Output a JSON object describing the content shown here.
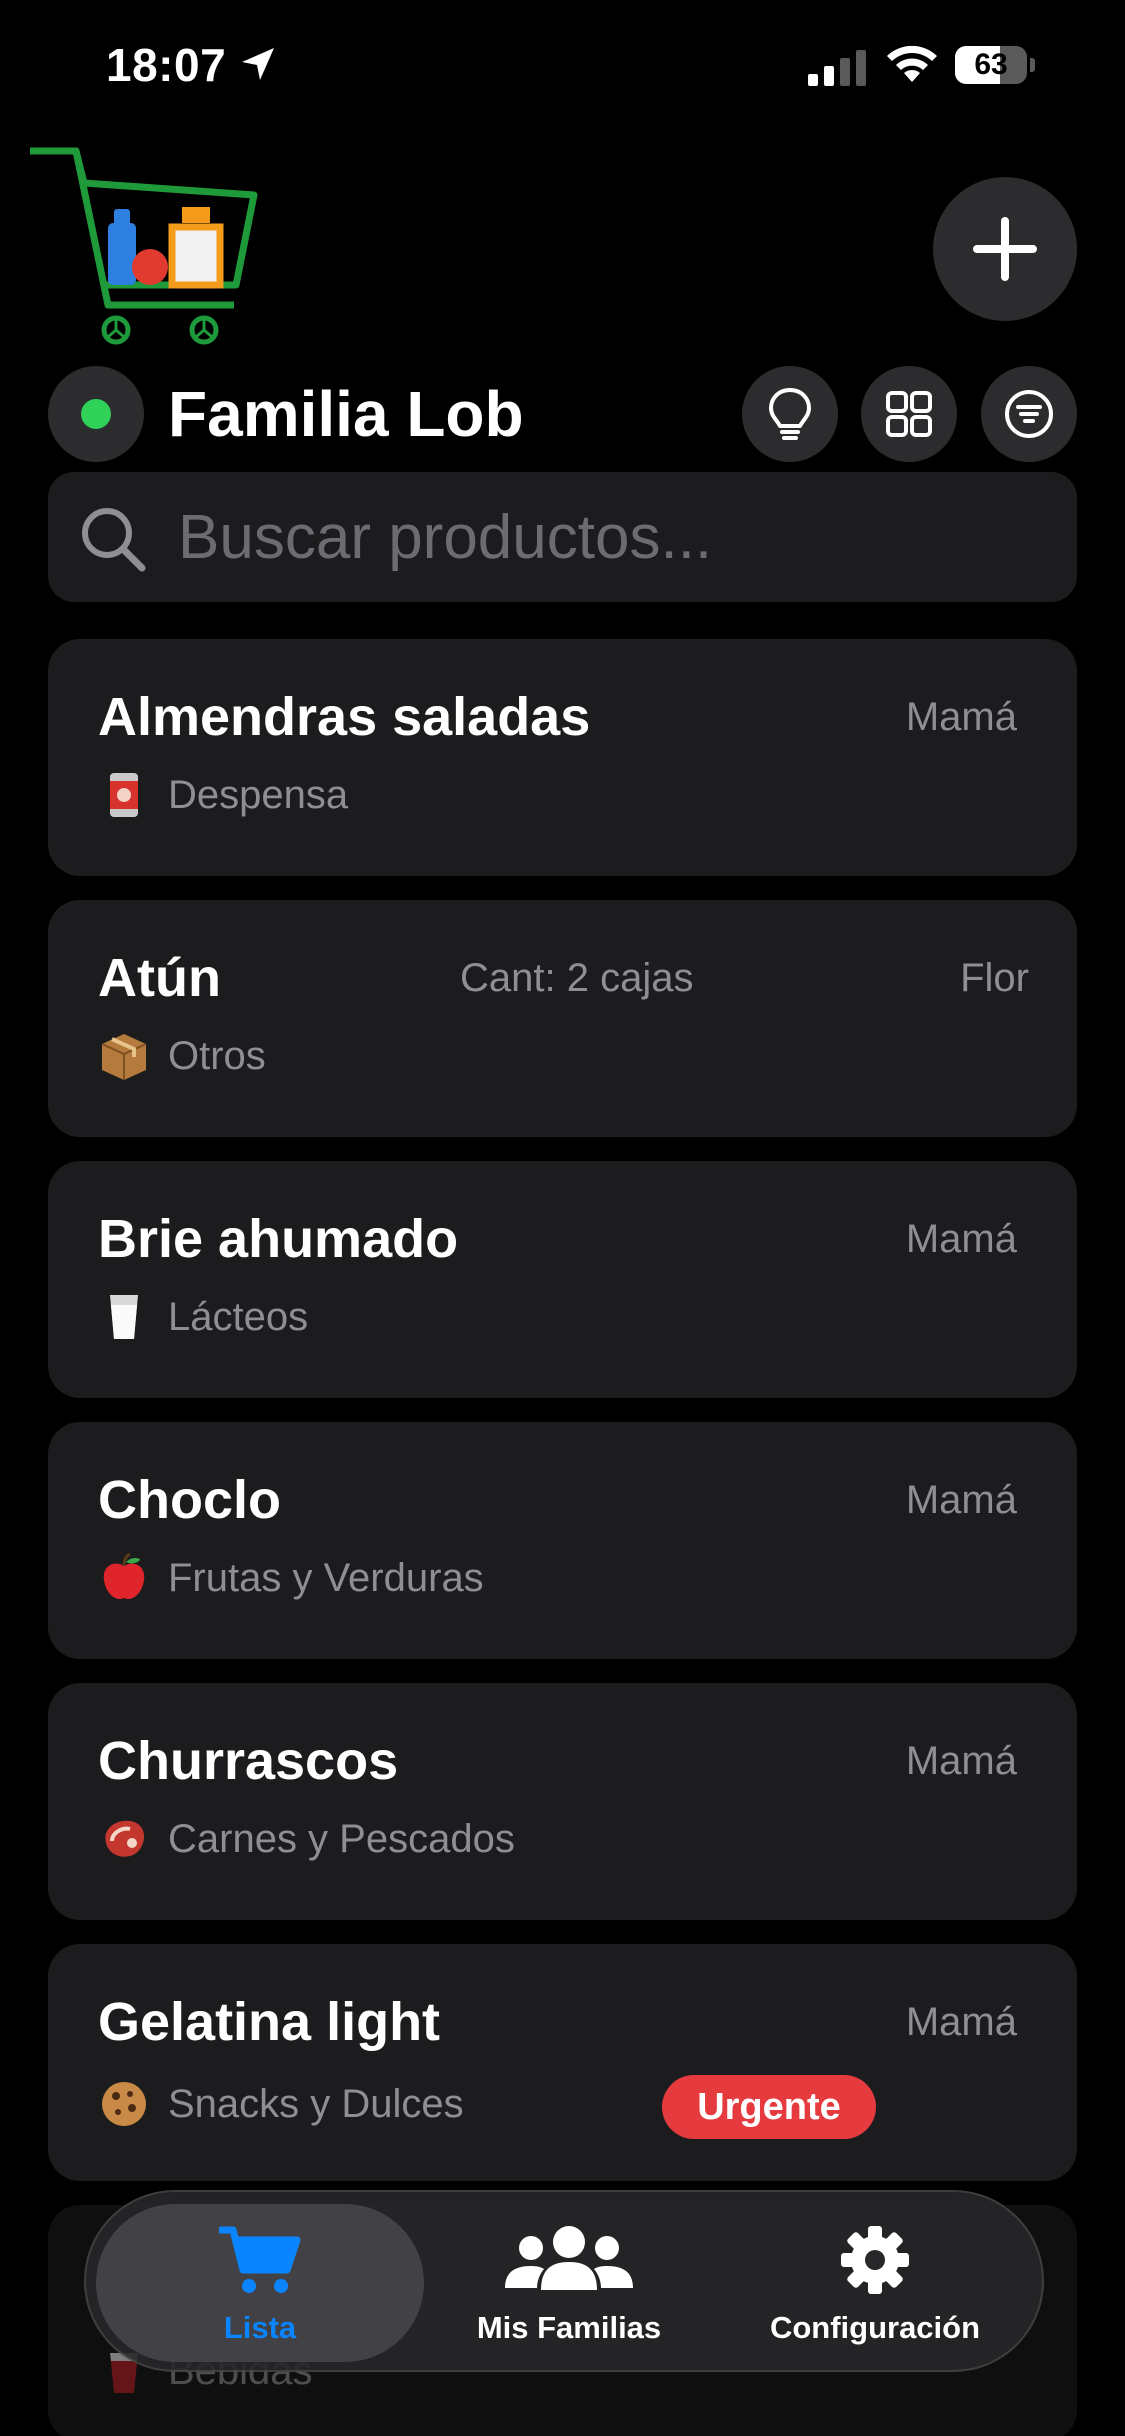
{
  "status_bar": {
    "time": "18:07",
    "battery_percent": "63",
    "battery_level": 0.63
  },
  "header": {
    "family_name": "Familia Lob",
    "connection_status_color": "#30d158"
  },
  "search": {
    "placeholder": "Buscar productos..."
  },
  "products": [
    {
      "name": "Almendras saladas",
      "owner": "Mamá",
      "category_icon": "canned-food-icon",
      "category": "Despensa"
    },
    {
      "name": "Atún",
      "quantity": "Cant: 2 cajas",
      "owner": "Flor",
      "category_icon": "package-icon",
      "category": "Otros"
    },
    {
      "name": "Brie ahumado",
      "owner": "Mamá",
      "category_icon": "milk-glass-icon",
      "category": "Lácteos"
    },
    {
      "name": "Choclo",
      "owner": "Mamá",
      "category_icon": "apple-icon",
      "category": "Frutas y Verduras"
    },
    {
      "name": "Churrascos",
      "owner": "Mamá",
      "category_icon": "steak-icon",
      "category": "Carnes y Pescados"
    },
    {
      "name": "Gelatina light",
      "owner": "Mamá",
      "category_icon": "cookie-icon",
      "category": "Snacks y Dulces",
      "badge": "Urgente"
    },
    {
      "category_icon": "cup-icon",
      "category": "Bebidas"
    }
  ],
  "tab_bar": {
    "tabs": [
      {
        "label": "Lista",
        "icon": "cart-icon",
        "active": true
      },
      {
        "label": "Mis Familias",
        "icon": "people-icon",
        "active": false
      },
      {
        "label": "Configuración",
        "icon": "gear-icon",
        "active": false
      }
    ]
  },
  "colors": {
    "accent": "#0a84ff",
    "urgent": "#e53a3e",
    "online": "#30d158",
    "card_background": "#1c1c1e"
  }
}
